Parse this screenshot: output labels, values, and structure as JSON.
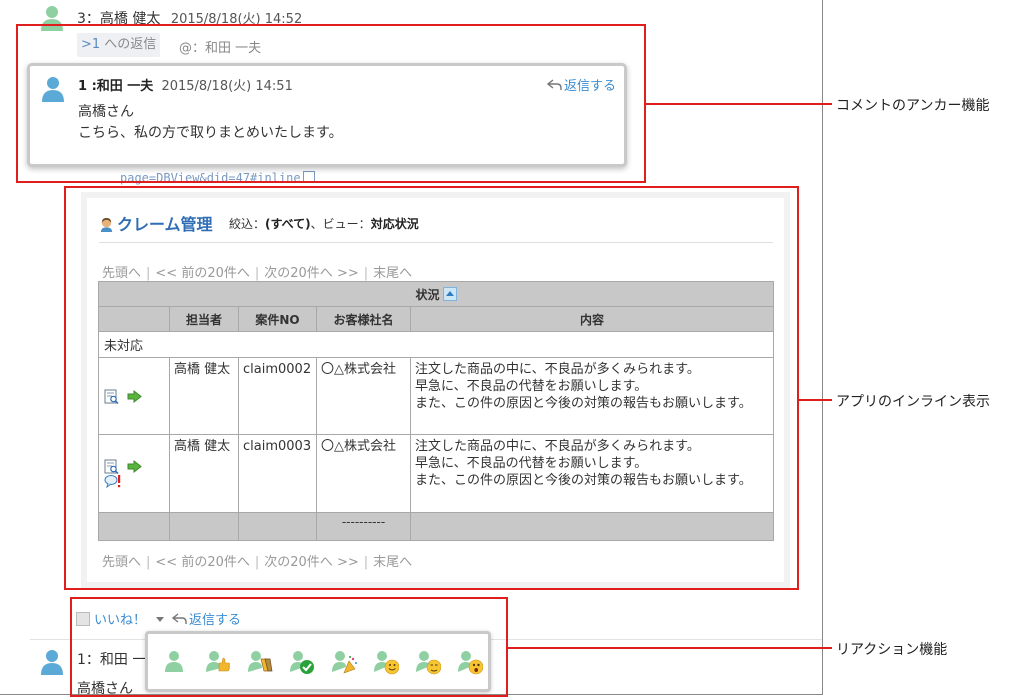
{
  "comment3": {
    "author": "3：高橋 健太",
    "date": "2015/8/18(火) 14:52"
  },
  "reply_tag": {
    "anchor": ">1",
    "suffix": " への返信"
  },
  "mention": "@：和田 一夫",
  "popup": {
    "author": "1 :和田 一夫",
    "date": "2015/8/18(火) 14:51",
    "reply_label": "返信する",
    "line1": "高橋さん",
    "line2": "こちら、私の方で取りまとめいたします。"
  },
  "faded_url": "page=DBView&did=47#inline",
  "inline_app": {
    "title": "クレーム管理",
    "filter_label": "絞込：",
    "filter_value": "(すべて)",
    "view_label": "、ビュー：",
    "view_value": "対応状況",
    "pager": {
      "first": "先頭へ",
      "prev": "<< 前の20件へ",
      "next": "次の20件へ >>",
      "last": "末尾へ"
    },
    "columns": {
      "status": "状況",
      "owner": "担当者",
      "case_no": "案件NO",
      "customer": "お客様社名",
      "content": "内容"
    },
    "group": "未対応",
    "rows": [
      {
        "owner": "高橋 健太",
        "case_no": "claim0002",
        "customer": "〇△株式会社",
        "c1": "注文した商品の中に、不良品が多くみられます。",
        "c2": "早急に、不良品の代替をお願いします。",
        "c3": "また、この件の原因と今後の対策の報告もお願いします。"
      },
      {
        "owner": "高橋 健太",
        "case_no": "claim0003",
        "customer": "〇△株式会社",
        "c1": "注文した商品の中に、不良品が多くみられます。",
        "c2": "早急に、不良品の代替をお願いします。",
        "c3": "また、この件の原因と今後の対策の報告もお願いします。"
      }
    ],
    "footer_dash": "----------"
  },
  "actions": {
    "like": "いいね！",
    "reply": "返信する"
  },
  "comment1": {
    "author": "1：和田 一",
    "body": "高橋さん"
  },
  "reactions": [
    "person-icon",
    "thumbs-up-icon",
    "clap-icon",
    "check-icon",
    "party-icon",
    "smile-icon",
    "sweat-icon",
    "surprised-icon"
  ],
  "callouts": {
    "anchor": "コメントのアンカー機能",
    "inline": "アプリのインライン表示",
    "reaction": "リアクション機能"
  },
  "colors": {
    "accent": "#3a8cd1",
    "callout_red": "#e01e1e",
    "avatar_green": "#8fd0a2",
    "avatar_blue": "#5aa9d6"
  }
}
